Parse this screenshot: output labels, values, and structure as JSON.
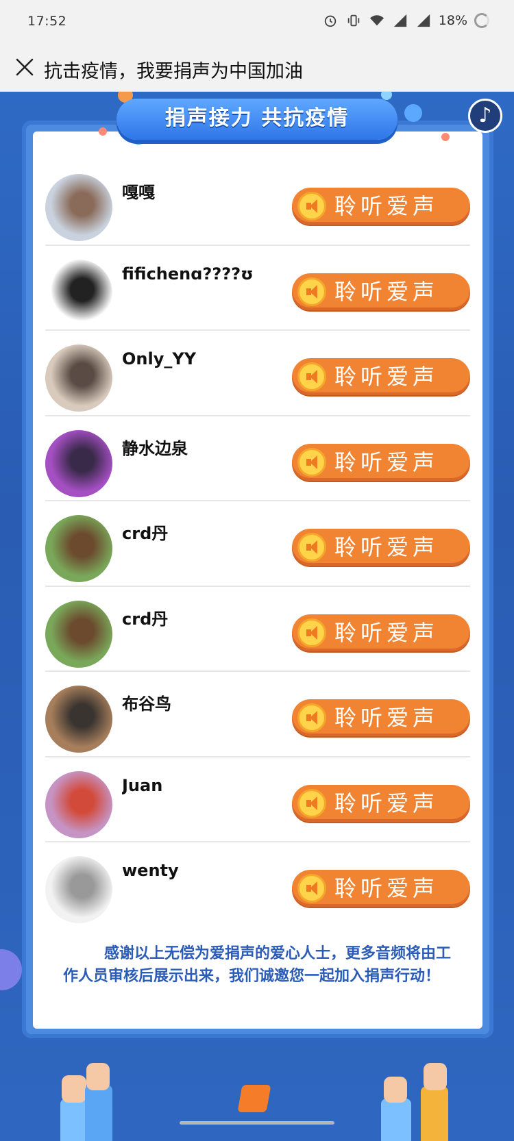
{
  "status_bar": {
    "time": "17:52",
    "battery": "18%",
    "icons": [
      "alarm-icon",
      "vibrate-icon",
      "wifi-icon",
      "signal-icon",
      "signal-icon",
      "battery-icon"
    ]
  },
  "nav": {
    "title": "抗击疫情，我要捐声为中国加油",
    "close_icon": "close-icon"
  },
  "banner": {
    "title": "捐声接力 共抗疫情"
  },
  "music_button": {
    "icon": "music-note-icon",
    "glyph": "♪"
  },
  "donors": [
    {
      "name": "嘎嘎",
      "button": "聆听爱声",
      "avatar_colors": [
        "#c9d2de",
        "#8a6b5a"
      ]
    },
    {
      "name": "fifichenɑ????ʊ",
      "button": "聆听爱声",
      "avatar_colors": [
        "#ffffff",
        "#222222"
      ]
    },
    {
      "name": "Only_YY",
      "button": "聆听爱声",
      "avatar_colors": [
        "#d8cbbd",
        "#5a4c44"
      ]
    },
    {
      "name": "静水边泉",
      "button": "聆听爱声",
      "avatar_colors": [
        "#a44fc2",
        "#3a2a4a"
      ]
    },
    {
      "name": "crd丹",
      "button": "聆听爱声",
      "avatar_colors": [
        "#7aa85a",
        "#6b4a2e"
      ]
    },
    {
      "name": "crd丹",
      "button": "聆听爱声",
      "avatar_colors": [
        "#7aa85a",
        "#6b4a2e"
      ]
    },
    {
      "name": "布谷鸟",
      "button": "聆听爱声",
      "avatar_colors": [
        "#a67e5b",
        "#3a3430"
      ]
    },
    {
      "name": "Juan",
      "button": "聆听爱声",
      "avatar_colors": [
        "#c694c4",
        "#d24a3a"
      ]
    },
    {
      "name": "wenty",
      "button": "聆听爱声",
      "avatar_colors": [
        "#f2f2f2",
        "#999999"
      ]
    }
  ],
  "footer": {
    "thanks": "感谢以上无偿为爱捐声的爱心人士，更多音频将由工作人员审核后展示出来，我们诚邀您一起加入捐声行动！"
  },
  "colors": {
    "page_bg": "#2b5fb6",
    "button": "#f08433",
    "text_blue": "#2b5cb8"
  }
}
